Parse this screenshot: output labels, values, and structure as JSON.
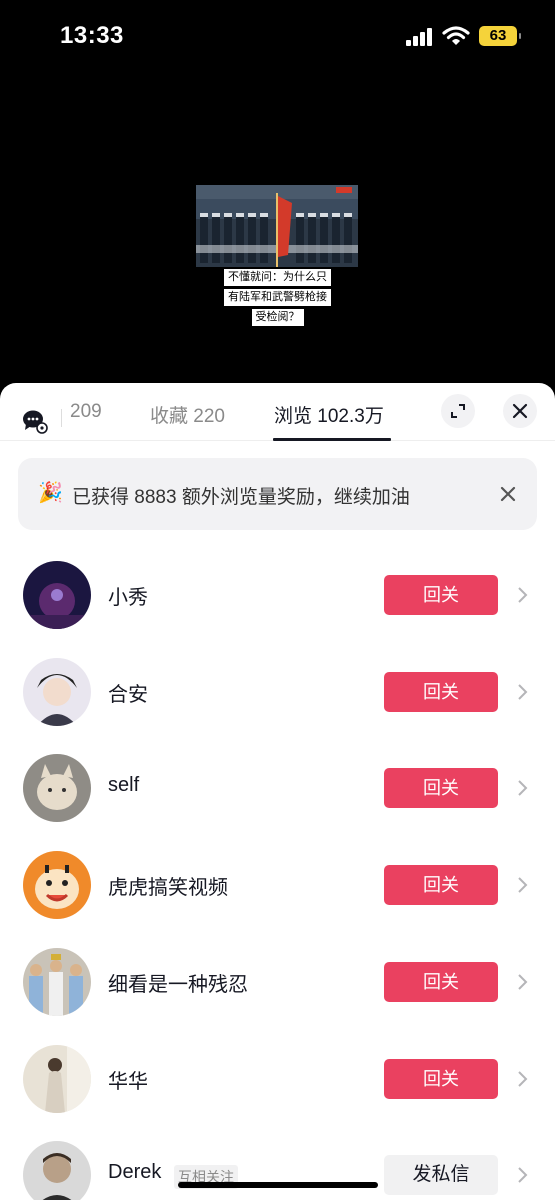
{
  "status_bar": {
    "time": "13:33",
    "battery": "63"
  },
  "video": {
    "caption_lines": [
      "不懂就问：为什么只",
      "有陆军和武警劈枪接",
      "受检阅？"
    ]
  },
  "tabs": [
    {
      "label": "209",
      "active": false
    },
    {
      "label": "收藏 220",
      "active": false
    },
    {
      "label": "浏览 102.3万",
      "active": true
    }
  ],
  "banner": {
    "icon": "party-popper-icon",
    "text": "已获得 8883 额外浏览量奖励，继续加油"
  },
  "users": [
    {
      "name": "小秀",
      "action": "回关"
    },
    {
      "name": "合安",
      "action": "回关"
    },
    {
      "name": "self",
      "action": "回关"
    },
    {
      "name": "虎虎搞笑视频",
      "action": "回关"
    },
    {
      "name": "细看是一种残忍",
      "action": "回关"
    },
    {
      "name": "华华",
      "action": "回关"
    },
    {
      "name": "Derek",
      "tag": "互相关注",
      "action": "发私信"
    }
  ],
  "colors": {
    "follow_button": "#ea4160",
    "battery": "#f5d33a"
  }
}
